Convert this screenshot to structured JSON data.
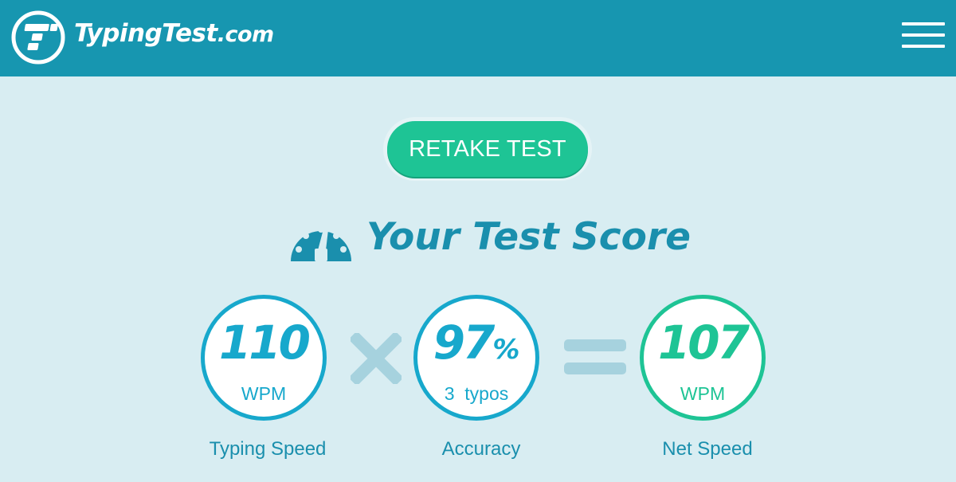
{
  "header": {
    "logo_text": "TypingTest",
    "logo_suffix": ".com",
    "icons": {
      "logo": "typingtest-logo-icon",
      "menu": "hamburger-menu-icon"
    },
    "background_color": "#1796b0"
  },
  "actions": {
    "retake_label": "RETAKE TEST"
  },
  "score": {
    "title": "Your Test Score",
    "title_icon": "speedometer-icon",
    "typing_speed": {
      "value": "110",
      "unit": "WPM",
      "caption": "Typing Speed"
    },
    "operator_multiply": "multiply-icon",
    "accuracy": {
      "value": "97",
      "suffix": "%",
      "detail": "3  typos",
      "caption": "Accuracy"
    },
    "operator_equals": "equals-icon",
    "net_speed": {
      "value": "107",
      "unit": "WPM",
      "caption": "Net Speed"
    }
  },
  "colors": {
    "page_background": "#d8edf2",
    "accent_blue": "#17a8cc",
    "accent_green": "#1ec495",
    "title_blue": "#1a8fad",
    "operator_gray": "#a6d2de"
  }
}
